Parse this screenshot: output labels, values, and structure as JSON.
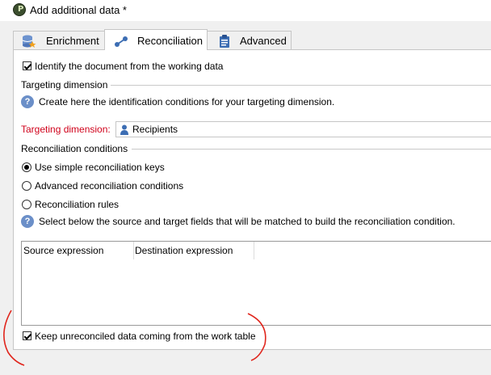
{
  "window": {
    "title": "Add additional data *",
    "app_icon_glyph": "P"
  },
  "tabs": [
    {
      "label": "Enrichment",
      "icon": "database-star-icon",
      "active": false
    },
    {
      "label": "Reconciliation",
      "icon": "link-nodes-icon",
      "active": true
    },
    {
      "label": "Advanced",
      "icon": "clipboard-icon",
      "active": false
    }
  ],
  "reconciliation": {
    "identify_checkbox": {
      "label": "Identify the document from the working data",
      "checked": true
    },
    "targeting_section": "Targeting dimension",
    "targeting_help": "Create here the identification conditions for your targeting dimension.",
    "targeting_dimension": {
      "label": "Targeting dimension:",
      "value": "Recipients",
      "label_color": "#d0021b"
    },
    "conditions_section": "Reconciliation conditions",
    "options": [
      {
        "label": "Use simple reconciliation keys",
        "selected": true
      },
      {
        "label": "Advanced reconciliation conditions",
        "selected": false
      },
      {
        "label": "Reconciliation rules",
        "selected": false
      }
    ],
    "fields_help": "Select below the source and target fields that will be matched to build the reconciliation condition.",
    "grid": {
      "columns": [
        "Source expression",
        "Destination expression"
      ],
      "rows": []
    },
    "keep_checkbox": {
      "label": "Keep unreconciled data coming from the work table",
      "checked": true
    }
  },
  "annotation_color": "#e0261d"
}
